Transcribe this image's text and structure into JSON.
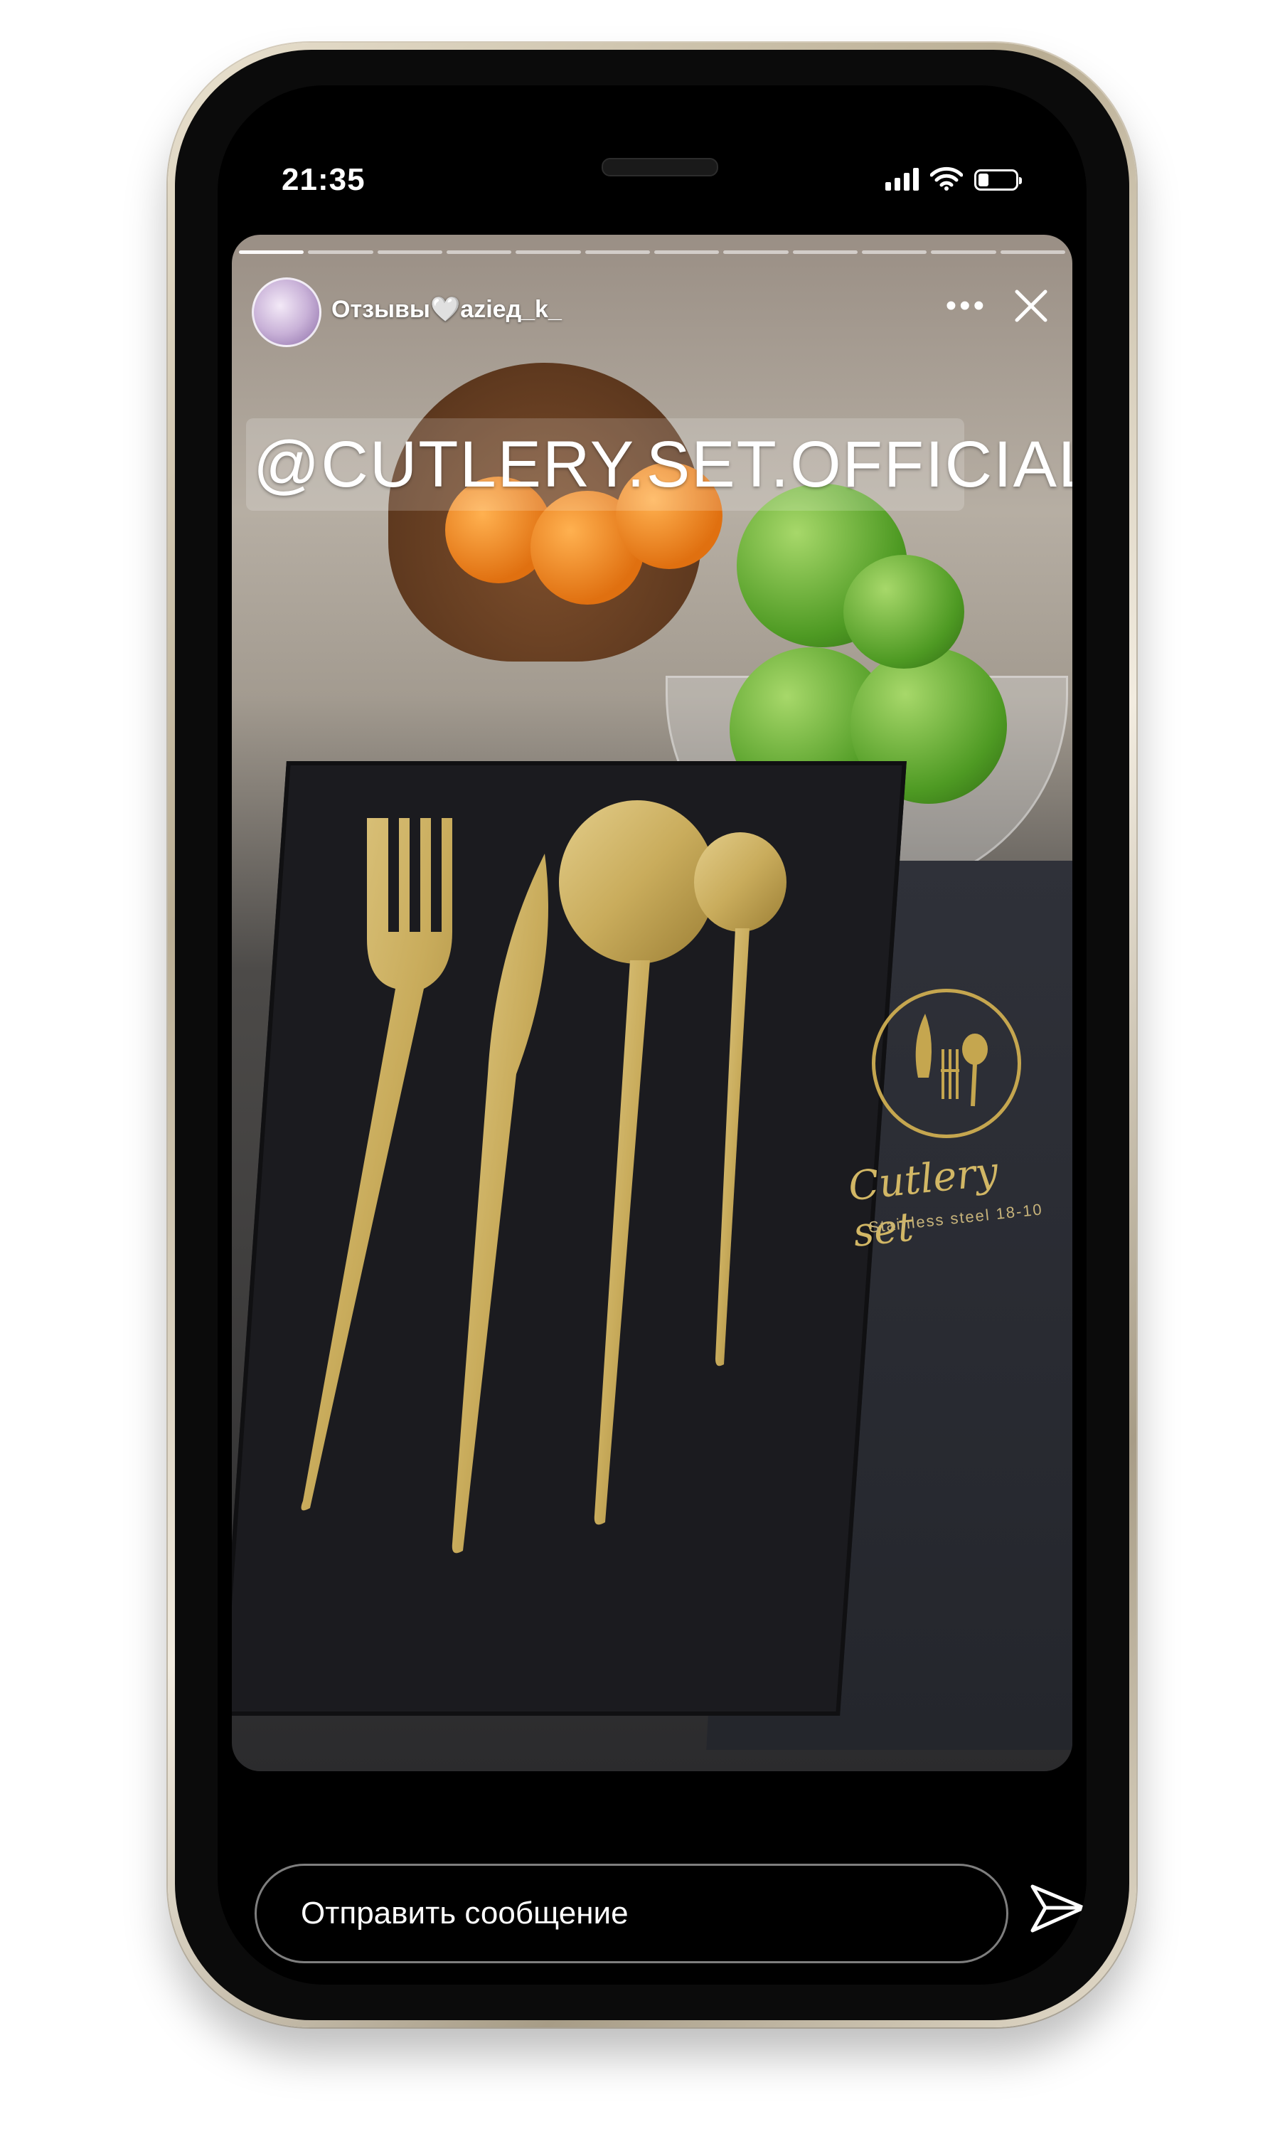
{
  "status_bar": {
    "time": "21:35",
    "icons": [
      "signal-icon",
      "wifi-icon",
      "battery-icon"
    ]
  },
  "story": {
    "username": "Отзывы🤍azieд_k_",
    "mention": "@CUTLERY.SET.OFFICIAL",
    "product_logo": {
      "name": "Cutlery set",
      "subtitle": "Stainless steel 18-10"
    }
  },
  "footer": {
    "message_placeholder": "Отправить сообщение"
  },
  "colors": {
    "background": "#000000",
    "text": "#ffffff",
    "gold": "#c5a64f"
  }
}
